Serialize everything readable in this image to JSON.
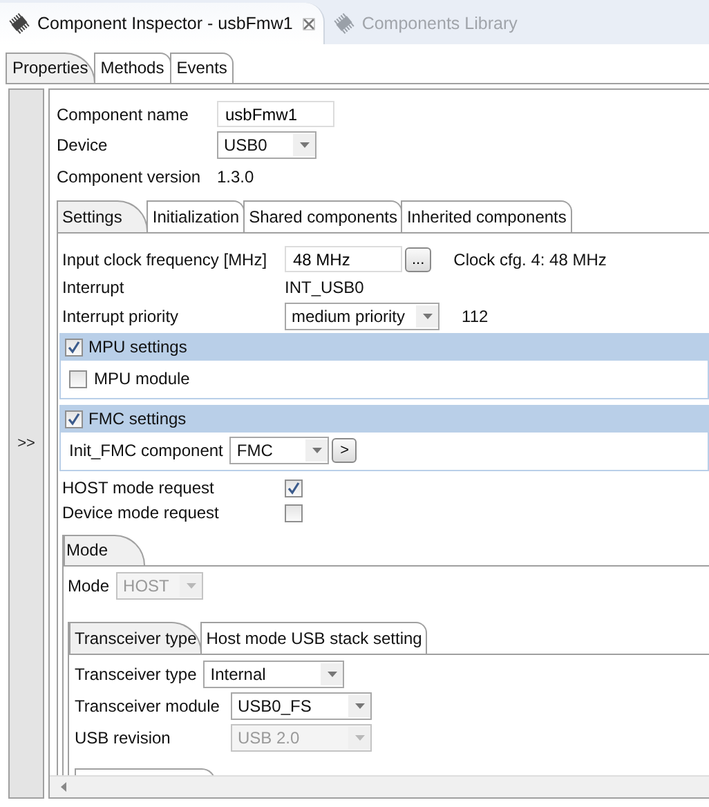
{
  "view_tabs": [
    {
      "label": "Component Inspector - usbFmw1",
      "selected": true,
      "closable": true
    },
    {
      "label": "Components Library",
      "selected": false,
      "closable": false
    }
  ],
  "inspector_tabs": [
    {
      "label": "Properties",
      "selected": true
    },
    {
      "label": "Methods",
      "selected": false
    },
    {
      "label": "Events",
      "selected": false
    }
  ],
  "sidebar": {
    "toggle": ">>"
  },
  "header_fields": [
    {
      "kind": "text",
      "label": "Component name",
      "value": "usbFmw1"
    },
    {
      "kind": "select",
      "label": "Device",
      "value": "USB0",
      "disabled": false
    },
    {
      "kind": "static",
      "label": "Component version",
      "value": "1.3.0"
    }
  ],
  "settings_tabs": [
    {
      "label": "Settings",
      "selected": true
    },
    {
      "label": "Initialization",
      "selected": false
    },
    {
      "label": "Shared components",
      "selected": false
    },
    {
      "label": "Inherited components",
      "selected": false
    }
  ],
  "settings": [
    {
      "kind": "text",
      "label": "Input clock frequency [MHz]",
      "value": "48 MHz",
      "button": "...",
      "note": "Clock cfg. 4: 48 MHz"
    },
    {
      "kind": "static",
      "label": "Interrupt",
      "value": "INT_USB0"
    },
    {
      "kind": "select",
      "label": "Interrupt priority",
      "value": "medium priority",
      "disabled": false,
      "note": "112"
    },
    {
      "kind": "group",
      "title": "MPU settings",
      "checked": true,
      "children": [
        {
          "kind": "checkbox",
          "label": "MPU module",
          "checked": false
        }
      ]
    },
    {
      "kind": "group",
      "title": "FMC settings",
      "checked": true,
      "children": [
        {
          "kind": "select",
          "label": "Init_FMC component",
          "value": "FMC",
          "disabled": false,
          "button": ">"
        }
      ]
    },
    {
      "kind": "checkbox",
      "label": "HOST mode request",
      "checked": true
    },
    {
      "kind": "checkbox",
      "label": "Device mode request",
      "checked": false
    }
  ],
  "mode_tabs": [
    {
      "label": "Mode",
      "selected": true
    }
  ],
  "mode_fields": [
    {
      "kind": "select",
      "label": "Mode",
      "value": "HOST",
      "disabled": true
    }
  ],
  "transceiver_tabs": [
    {
      "label": "Transceiver type",
      "selected": true
    },
    {
      "label": "Host mode USB stack setting",
      "selected": false
    }
  ],
  "transceiver_fields": [
    {
      "kind": "select",
      "label": "Transceiver type",
      "value": "Internal",
      "disabled": false
    },
    {
      "kind": "select",
      "label": "Transceiver module",
      "value": "USB0_FS",
      "disabled": false
    },
    {
      "kind": "select",
      "label": "USB revision",
      "value": "USB 2.0",
      "disabled": true
    }
  ]
}
